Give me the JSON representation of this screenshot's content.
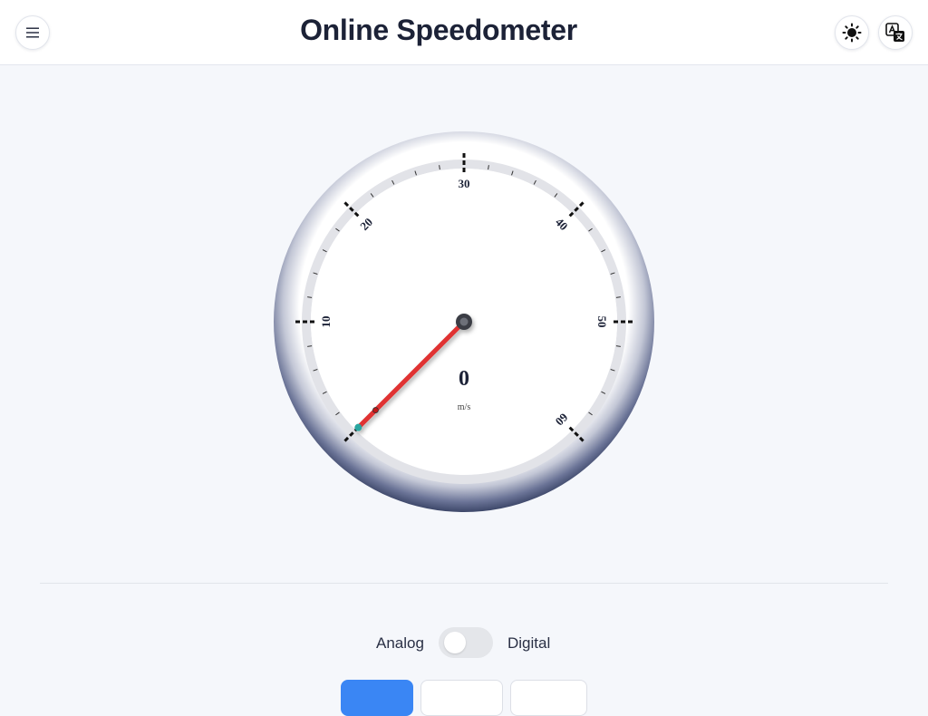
{
  "header": {
    "title": "Online Speedometer",
    "menu_icon": "hamburger-menu-icon",
    "theme_icon": "sun-icon",
    "language_icon": "translate-icon"
  },
  "speedometer": {
    "speed_value": "0",
    "unit": "m/s",
    "scale_min": 0,
    "scale_max": 60,
    "major_labels": [
      "10",
      "20",
      "30",
      "40",
      "50",
      "60"
    ],
    "needle_value": 0,
    "colors": {
      "needle": "#e03030",
      "bezel": "#3d4769",
      "needle_tip": "#2aa6a0",
      "face": "#ffffff"
    }
  },
  "mode_toggle": {
    "left_label": "Analog",
    "right_label": "Digital",
    "selected": "Analog"
  },
  "colors": {
    "accent": "#3a86f4",
    "background": "#f5f7fb"
  }
}
